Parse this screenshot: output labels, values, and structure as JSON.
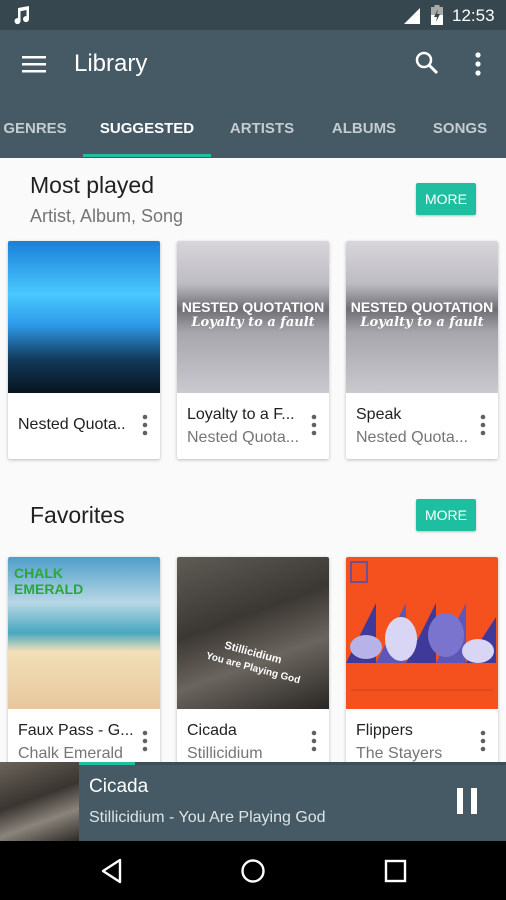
{
  "status_bar": {
    "time": "12:53",
    "icons": [
      "music-note-icon",
      "cell-signal-icon",
      "battery-charging-icon"
    ]
  },
  "app_bar": {
    "title": "Library",
    "icons": [
      "menu-icon",
      "search-icon",
      "more-vert-icon"
    ]
  },
  "tabs": [
    {
      "label": "GENRES",
      "active": false
    },
    {
      "label": "SUGGESTED",
      "active": true
    },
    {
      "label": "ARTISTS",
      "active": false
    },
    {
      "label": "ALBUMS",
      "active": false
    },
    {
      "label": "SONGS",
      "active": false
    }
  ],
  "sections": [
    {
      "title": "Most played",
      "subtitle": "Artist, Album, Song",
      "more_label": "MORE",
      "cards": [
        {
          "title": "Nested Quota..",
          "subtitle": "",
          "art": "crowd-concert"
        },
        {
          "title": "Loyalty to a F...",
          "subtitle": "Nested Quota...",
          "art": "lake-nested-quotation"
        },
        {
          "title": "Speak",
          "subtitle": "Nested Quota...",
          "art": "lake-nested-quotation"
        }
      ]
    },
    {
      "title": "Favorites",
      "subtitle": "",
      "more_label": "MORE",
      "cards": [
        {
          "title": "Faux Pass - G...",
          "subtitle": "Chalk Emerald",
          "art": "beach-chalk-emerald"
        },
        {
          "title": "Cicada",
          "subtitle": "Stillicidium",
          "art": "ruins-stillicidium"
        },
        {
          "title": "Flippers",
          "subtitle": "The Stayers",
          "art": "orange-penguins"
        }
      ]
    }
  ],
  "art_text": {
    "nested_line1": "NESTED QUOTATION",
    "nested_line2": "Loyalty to a fault",
    "chalk": "CHALK EMERALD",
    "still_line1": "Stillicidium",
    "still_line2": "You are Playing God"
  },
  "now_playing": {
    "title": "Cicada",
    "subtitle": "Stillicidium - You Are Playing God",
    "progress_fraction": 0.13,
    "state": "playing",
    "pause_icon": "pause-icon"
  },
  "nav_bar": {
    "icons": [
      "back-icon",
      "home-icon",
      "recents-icon"
    ]
  },
  "colors": {
    "primary": "#455a64",
    "primary_dark": "#37474f",
    "accent": "#1dbfa0"
  }
}
